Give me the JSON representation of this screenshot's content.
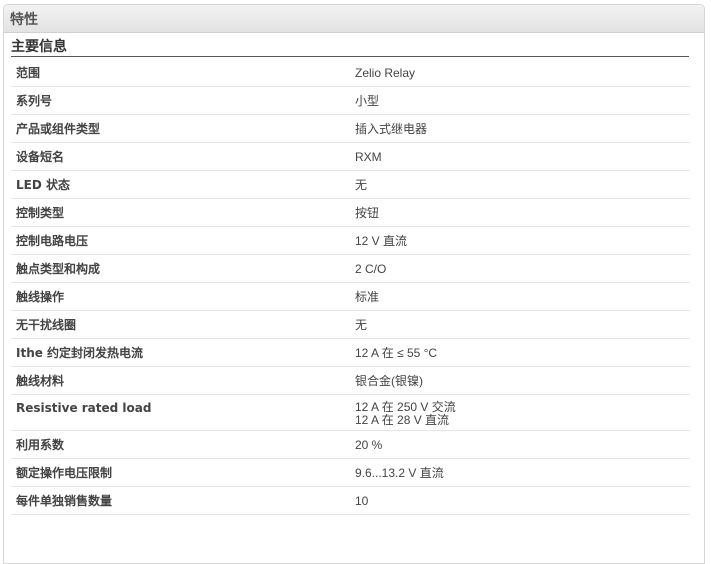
{
  "panel": {
    "title": "特性"
  },
  "section": {
    "title": "主要信息"
  },
  "rows": [
    {
      "label": "范围",
      "values": [
        "Zelio Relay"
      ]
    },
    {
      "label": "系列号",
      "values": [
        "小型"
      ]
    },
    {
      "label": "产品或组件类型",
      "values": [
        "插入式继电器"
      ]
    },
    {
      "label": "设备短名",
      "values": [
        "RXM"
      ]
    },
    {
      "label": "LED 状态",
      "values": [
        "无"
      ]
    },
    {
      "label": "控制类型",
      "values": [
        "按钮"
      ]
    },
    {
      "label": "控制电路电压",
      "values": [
        "12 V 直流"
      ]
    },
    {
      "label": "触点类型和构成",
      "values": [
        "2 C/O"
      ]
    },
    {
      "label": "触线操作",
      "values": [
        "标准"
      ]
    },
    {
      "label": "无干扰线圈",
      "values": [
        "无"
      ]
    },
    {
      "label": "Ithe 约定封闭发热电流",
      "values": [
        "12 A 在 ≤ 55 °C"
      ]
    },
    {
      "label": "触线材料",
      "values": [
        "银合金(银镍)"
      ]
    },
    {
      "label": "Resistive rated load",
      "values": [
        "12 A 在 250 V 交流",
        "12 A 在 28 V 直流"
      ]
    },
    {
      "label": "利用系数",
      "values": [
        "20 %"
      ]
    },
    {
      "label": "额定操作电压限制",
      "values": [
        "9.6...13.2 V 直流"
      ]
    },
    {
      "label": "每件单独销售数量",
      "values": [
        "10"
      ]
    }
  ]
}
